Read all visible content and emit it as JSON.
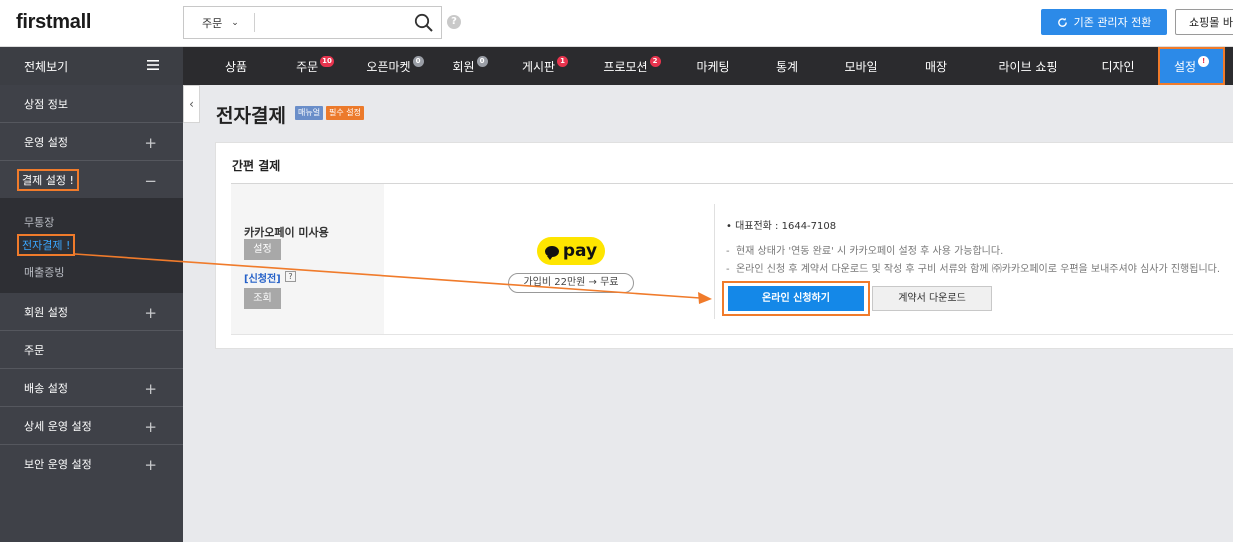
{
  "header": {
    "logo": "firstmall",
    "search_select": "주문",
    "search_placeholder": "",
    "help": "?",
    "switch_button": "기존 관리자 전환",
    "shop_button": "쇼핑몰 바로가기"
  },
  "nav": {
    "all_view": "전체보기",
    "items": [
      {
        "label": "상품",
        "badge": ""
      },
      {
        "label": "주문",
        "badge": "10"
      },
      {
        "label": "오픈마켓",
        "badge": "0"
      },
      {
        "label": "회원",
        "badge": "0"
      },
      {
        "label": "게시판",
        "badge": "1"
      },
      {
        "label": "프로모션",
        "badge": "2"
      },
      {
        "label": "마케팅",
        "badge": ""
      },
      {
        "label": "통계",
        "badge": ""
      },
      {
        "label": "모바일",
        "badge": ""
      },
      {
        "label": "매장",
        "badge": ""
      },
      {
        "label": "라이브 쇼핑",
        "badge": ""
      },
      {
        "label": "디자인",
        "badge": ""
      },
      {
        "label": "설정",
        "badge": "!"
      }
    ]
  },
  "sidebar": {
    "items": [
      {
        "label": "상점 정보"
      },
      {
        "label": "운영 설정"
      },
      {
        "label": "결제 설정 !"
      },
      {
        "label": "회원 설정"
      },
      {
        "label": "주문"
      },
      {
        "label": "배송 설정"
      },
      {
        "label": "상세 운영 설정"
      },
      {
        "label": "보안 운영 설정"
      }
    ],
    "plus": "+",
    "minus": "−",
    "sub_items": [
      {
        "label": "무통장"
      },
      {
        "label": "전자결제 !"
      },
      {
        "label": "매출증빙"
      }
    ]
  },
  "page": {
    "title": "전자결제",
    "tag_manual": "매뉴얼",
    "tag_required": "필수 설정"
  },
  "card": {
    "title": "간편 결제",
    "label": "카카오페이 미사용",
    "setting_button": "설정",
    "apply_status": "[신청전]",
    "q": "?",
    "lookup_button": "조회",
    "pay_text": "pay",
    "fee_text": "가입비 22만원 → 무료",
    "info_phone": "대표전화 : 1644-7108",
    "info_line1": "현재 상태가 '연동 완료' 시 카카오페이 설정 후 사용 가능합니다.",
    "info_line2": "온라인 신청 후 계약서 다운로드 및 작성 후 구비 서류와 함께 ㈜카카오페이로 우편을 보내주셔야 심사가 진행됩니다.",
    "apply_button": "온라인 신청하기",
    "download_button": "계약서 다운로드"
  },
  "colors": {
    "accent": "#2c8ae8",
    "highlight": "#f07b2b",
    "kakao": "#fee500"
  }
}
